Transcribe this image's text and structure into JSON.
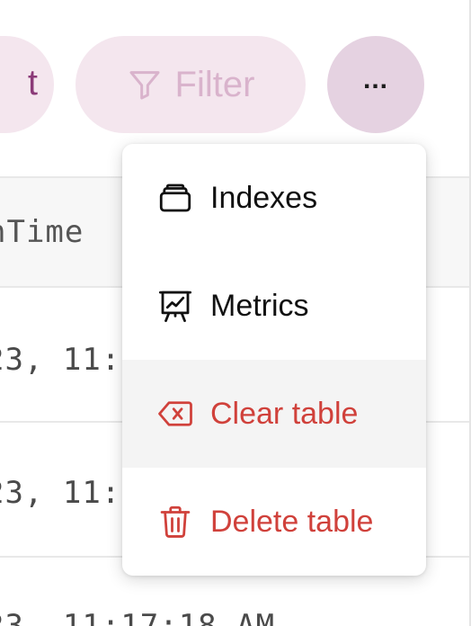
{
  "toolbar": {
    "partial_label": "t",
    "filter_label": "Filter",
    "more_label": "..."
  },
  "table": {
    "header_fragment": "nTime",
    "rows": [
      "23, 11:",
      "23, 11:",
      "23, 11:17:18 AM"
    ]
  },
  "menu": {
    "items": [
      {
        "label": "Indexes",
        "icon": "stack-icon"
      },
      {
        "label": "Metrics",
        "icon": "presentation-chart-icon"
      },
      {
        "label": "Clear table",
        "icon": "backspace-x-icon"
      },
      {
        "label": "Delete table",
        "icon": "trash-icon"
      }
    ]
  },
  "colors": {
    "accent_pill": "#f4e6ee",
    "more_button": "#e5d2e1",
    "danger": "#d0413b"
  }
}
